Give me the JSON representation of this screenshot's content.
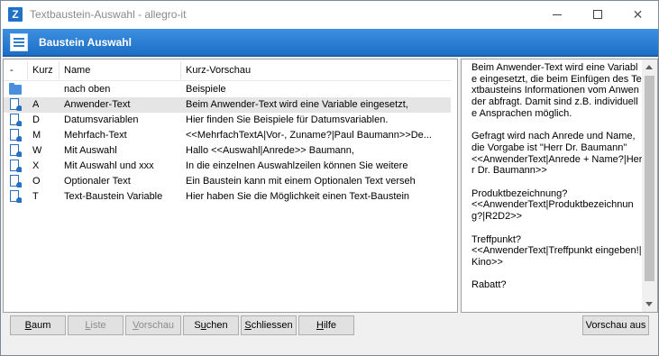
{
  "window": {
    "icon_letter": "Z",
    "title": "Textbaustein-Auswahl - allegro-it"
  },
  "header": {
    "title": "Baustein Auswahl"
  },
  "list": {
    "columns": [
      "-",
      "Kurz",
      "Name",
      "Kurz-Vorschau"
    ],
    "rows": [
      {
        "icon": "folder-icon",
        "kurz": "",
        "name": "nach oben",
        "preview": "Beispiele",
        "selected": false
      },
      {
        "icon": "text-module-icon",
        "kurz": "A",
        "name": "Anwender-Text",
        "preview": "Beim Anwender-Text wird eine Variable eingesetzt,",
        "selected": true
      },
      {
        "icon": "text-module-icon",
        "kurz": "D",
        "name": "Datumsvariablen",
        "preview": "Hier finden Sie Beispiele für Datumsvariablen.",
        "selected": false
      },
      {
        "icon": "text-module-icon",
        "kurz": "M",
        "name": "Mehrfach-Text",
        "preview": "<<MehrfachTextA|Vor-, Zuname?|Paul Baumann>>De...",
        "selected": false
      },
      {
        "icon": "text-module-icon",
        "kurz": "W",
        "name": "Mit Auswahl",
        "preview": "Hallo <<Auswahl|Anrede>> Baumann,",
        "selected": false
      },
      {
        "icon": "text-module-icon",
        "kurz": "X",
        "name": "Mit Auswahl und xxx",
        "preview": "In die einzelnen Auswahlzeilen können Sie weitere",
        "selected": false
      },
      {
        "icon": "text-module-icon",
        "kurz": "O",
        "name": "Optionaler Text",
        "preview": "Ein Baustein kann mit einem Optionalen Text verseh",
        "selected": false
      },
      {
        "icon": "text-module-icon",
        "kurz": "T",
        "name": "Text-Baustein Variable",
        "preview": "Hier haben Sie die Möglichkeit einen Text-Baustein",
        "selected": false
      }
    ]
  },
  "preview": {
    "text": "Beim Anwender-Text wird eine Variable eingesetzt, die beim Einfügen des Textbausteins Informationen vom Anwender abfragt. Damit sind z.B. individuelle Ansprachen möglich.\n\nGefragt wird nach Anrede und Name, die Vorgabe ist \"Herr Dr. Baumann\"\n<<AnwenderText|Anrede + Name?|Herr Dr. Baumann>>\n\nProduktbezeichnung?\n<<AnwenderText|Produktbezeichnung?|R2D2>>\n\nTreffpunkt?\n<<AnwenderText|Treffpunkt eingeben!|Kino>>\n\nRabatt?"
  },
  "buttons": {
    "baum": {
      "accel": "B",
      "rest": "aum"
    },
    "liste": {
      "accel": "L",
      "rest": "iste"
    },
    "vorschau": {
      "accel": "V",
      "rest": "orschau"
    },
    "suchen": {
      "pre": "S",
      "accel": "u",
      "rest": "chen"
    },
    "schliessen": {
      "accel": "S",
      "rest": "chliessen"
    },
    "hilfe": {
      "accel": "H",
      "rest": "ilfe"
    },
    "vorschau_aus": "Vorschau aus"
  }
}
